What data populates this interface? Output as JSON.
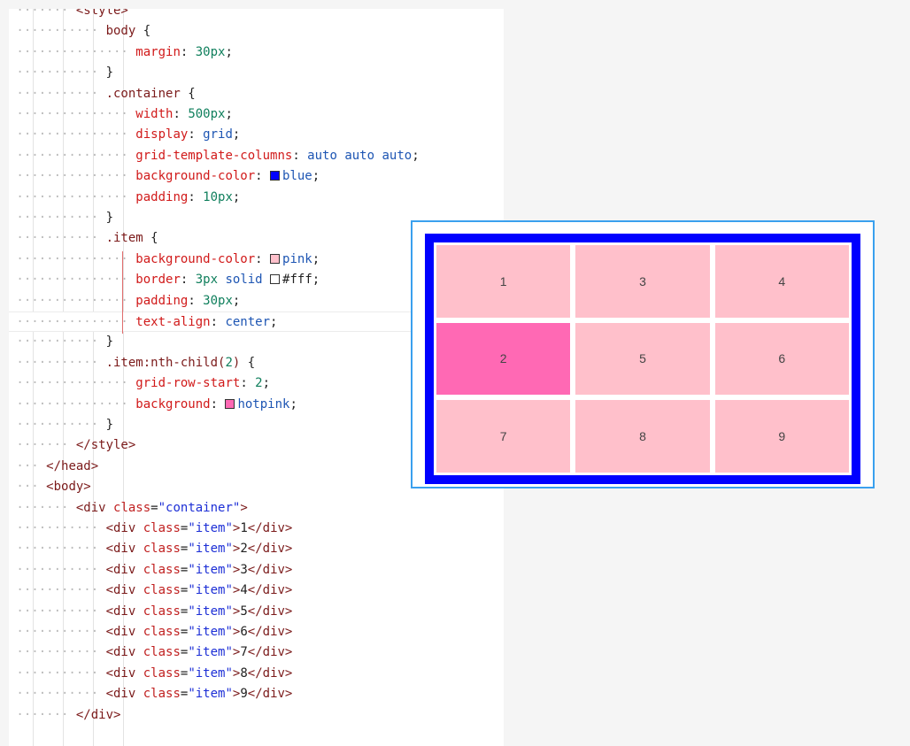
{
  "editor": {
    "lines": [
      {
        "indent": 2,
        "parts": [
          [
            "t-tag",
            "<style>"
          ]
        ]
      },
      {
        "indent": 3,
        "parts": [
          [
            "t-sel",
            "body"
          ],
          [
            "t-punc",
            " {"
          ]
        ]
      },
      {
        "indent": 4,
        "parts": [
          [
            "t-prop",
            "margin"
          ],
          [
            "t-punc",
            ": "
          ],
          [
            "t-num",
            "30px"
          ],
          [
            "t-punc",
            ";"
          ]
        ]
      },
      {
        "indent": 3,
        "parts": [
          [
            "t-punc",
            "}"
          ]
        ]
      },
      {
        "indent": 3,
        "parts": [
          [
            "t-sel",
            ".container"
          ],
          [
            "t-punc",
            " {"
          ]
        ]
      },
      {
        "indent": 4,
        "parts": [
          [
            "t-prop",
            "width"
          ],
          [
            "t-punc",
            ": "
          ],
          [
            "t-num",
            "500px"
          ],
          [
            "t-punc",
            ";"
          ]
        ]
      },
      {
        "indent": 4,
        "parts": [
          [
            "t-prop",
            "display"
          ],
          [
            "t-punc",
            ": "
          ],
          [
            "t-val",
            "grid"
          ],
          [
            "t-punc",
            ";"
          ]
        ]
      },
      {
        "indent": 4,
        "parts": [
          [
            "t-prop",
            "grid-template-columns"
          ],
          [
            "t-punc",
            ": "
          ],
          [
            "t-val",
            "auto auto auto"
          ],
          [
            "t-punc",
            ";"
          ]
        ]
      },
      {
        "indent": 4,
        "parts": [
          [
            "t-prop",
            "background-color"
          ],
          [
            "t-punc",
            ": "
          ],
          [
            "swatch",
            "#0000ff"
          ],
          [
            "t-val",
            "blue"
          ],
          [
            "t-punc",
            ";"
          ]
        ]
      },
      {
        "indent": 4,
        "parts": [
          [
            "t-prop",
            "padding"
          ],
          [
            "t-punc",
            ": "
          ],
          [
            "t-num",
            "10px"
          ],
          [
            "t-punc",
            ";"
          ]
        ]
      },
      {
        "indent": 3,
        "parts": [
          [
            "t-punc",
            "}"
          ]
        ]
      },
      {
        "indent": 3,
        "parts": [
          [
            "t-sel",
            ".item"
          ],
          [
            "t-punc",
            " {"
          ]
        ]
      },
      {
        "indent": 4,
        "parts": [
          [
            "t-prop",
            "background-color"
          ],
          [
            "t-punc",
            ": "
          ],
          [
            "swatch",
            "#ffc0cb"
          ],
          [
            "t-val",
            "pink"
          ],
          [
            "t-punc",
            ";"
          ]
        ]
      },
      {
        "indent": 4,
        "parts": [
          [
            "t-prop",
            "border"
          ],
          [
            "t-punc",
            ": "
          ],
          [
            "t-num",
            "3px"
          ],
          [
            "t-val",
            " solid "
          ],
          [
            "swatch",
            "#ffffff"
          ],
          [
            "t-punc",
            "#fff;"
          ]
        ]
      },
      {
        "indent": 4,
        "parts": [
          [
            "t-prop",
            "padding"
          ],
          [
            "t-punc",
            ": "
          ],
          [
            "t-num",
            "30px"
          ],
          [
            "t-punc",
            ";"
          ]
        ]
      },
      {
        "indent": 4,
        "highlight": true,
        "parts": [
          [
            "t-prop",
            "text-align"
          ],
          [
            "t-punc",
            ": "
          ],
          [
            "t-val",
            "center"
          ],
          [
            "t-punc",
            ";"
          ]
        ]
      },
      {
        "indent": 3,
        "parts": [
          [
            "t-punc",
            "}"
          ]
        ]
      },
      {
        "indent": 3,
        "parts": [
          [
            "t-sel",
            ".item:nth-child("
          ],
          [
            "t-num",
            "2"
          ],
          [
            "t-sel",
            ")"
          ],
          [
            "t-punc",
            " {"
          ]
        ]
      },
      {
        "indent": 4,
        "parts": [
          [
            "t-prop",
            "grid-row-start"
          ],
          [
            "t-punc",
            ": "
          ],
          [
            "t-num",
            "2"
          ],
          [
            "t-punc",
            ";"
          ]
        ]
      },
      {
        "indent": 4,
        "parts": [
          [
            "t-prop",
            "background"
          ],
          [
            "t-punc",
            ": "
          ],
          [
            "swatch",
            "#ff69b4"
          ],
          [
            "t-val",
            "hotpink"
          ],
          [
            "t-punc",
            ";"
          ]
        ]
      },
      {
        "indent": 3,
        "parts": [
          [
            "t-punc",
            "}"
          ]
        ]
      },
      {
        "indent": 2,
        "parts": [
          [
            "t-tag",
            "</style>"
          ]
        ]
      },
      {
        "indent": 1,
        "parts": [
          [
            "t-tag",
            "</head>"
          ]
        ]
      },
      {
        "indent": 1,
        "parts": [
          [
            "t-tag",
            "<body>"
          ]
        ]
      },
      {
        "indent": 2,
        "parts": [
          [
            "t-tag",
            "<div "
          ],
          [
            "t-attr",
            "class"
          ],
          [
            "t-punc",
            "="
          ],
          [
            "t-str",
            "\"container\""
          ],
          [
            "t-tag",
            ">"
          ]
        ]
      },
      {
        "indent": 3,
        "parts": [
          [
            "t-tag",
            "<div "
          ],
          [
            "t-attr",
            "class"
          ],
          [
            "t-punc",
            "="
          ],
          [
            "t-str",
            "\"item\""
          ],
          [
            "t-tag",
            ">"
          ],
          [
            "t-punc",
            "1"
          ],
          [
            "t-tag",
            "</div>"
          ]
        ]
      },
      {
        "indent": 3,
        "parts": [
          [
            "t-tag",
            "<div "
          ],
          [
            "t-attr",
            "class"
          ],
          [
            "t-punc",
            "="
          ],
          [
            "t-str",
            "\"item\""
          ],
          [
            "t-tag",
            ">"
          ],
          [
            "t-punc",
            "2"
          ],
          [
            "t-tag",
            "</div>"
          ]
        ]
      },
      {
        "indent": 3,
        "parts": [
          [
            "t-tag",
            "<div "
          ],
          [
            "t-attr",
            "class"
          ],
          [
            "t-punc",
            "="
          ],
          [
            "t-str",
            "\"item\""
          ],
          [
            "t-tag",
            ">"
          ],
          [
            "t-punc",
            "3"
          ],
          [
            "t-tag",
            "</div>"
          ]
        ]
      },
      {
        "indent": 3,
        "parts": [
          [
            "t-tag",
            "<div "
          ],
          [
            "t-attr",
            "class"
          ],
          [
            "t-punc",
            "="
          ],
          [
            "t-str",
            "\"item\""
          ],
          [
            "t-tag",
            ">"
          ],
          [
            "t-punc",
            "4"
          ],
          [
            "t-tag",
            "</div>"
          ]
        ]
      },
      {
        "indent": 3,
        "parts": [
          [
            "t-tag",
            "<div "
          ],
          [
            "t-attr",
            "class"
          ],
          [
            "t-punc",
            "="
          ],
          [
            "t-str",
            "\"item\""
          ],
          [
            "t-tag",
            ">"
          ],
          [
            "t-punc",
            "5"
          ],
          [
            "t-tag",
            "</div>"
          ]
        ]
      },
      {
        "indent": 3,
        "parts": [
          [
            "t-tag",
            "<div "
          ],
          [
            "t-attr",
            "class"
          ],
          [
            "t-punc",
            "="
          ],
          [
            "t-str",
            "\"item\""
          ],
          [
            "t-tag",
            ">"
          ],
          [
            "t-punc",
            "6"
          ],
          [
            "t-tag",
            "</div>"
          ]
        ]
      },
      {
        "indent": 3,
        "parts": [
          [
            "t-tag",
            "<div "
          ],
          [
            "t-attr",
            "class"
          ],
          [
            "t-punc",
            "="
          ],
          [
            "t-str",
            "\"item\""
          ],
          [
            "t-tag",
            ">"
          ],
          [
            "t-punc",
            "7"
          ],
          [
            "t-tag",
            "</div>"
          ]
        ]
      },
      {
        "indent": 3,
        "parts": [
          [
            "t-tag",
            "<div "
          ],
          [
            "t-attr",
            "class"
          ],
          [
            "t-punc",
            "="
          ],
          [
            "t-str",
            "\"item\""
          ],
          [
            "t-tag",
            ">"
          ],
          [
            "t-punc",
            "8"
          ],
          [
            "t-tag",
            "</div>"
          ]
        ]
      },
      {
        "indent": 3,
        "parts": [
          [
            "t-tag",
            "<div "
          ],
          [
            "t-attr",
            "class"
          ],
          [
            "t-punc",
            "="
          ],
          [
            "t-str",
            "\"item\""
          ],
          [
            "t-tag",
            ">"
          ],
          [
            "t-punc",
            "9"
          ],
          [
            "t-tag",
            "</div>"
          ]
        ]
      },
      {
        "indent": 2,
        "parts": [
          [
            "t-tag",
            "</div>"
          ]
        ]
      }
    ]
  },
  "preview": {
    "container_color": "#0000ff",
    "item_color": "#ffc0cb",
    "hot_color": "#ff69b4",
    "items": [
      "1",
      "2",
      "3",
      "4",
      "5",
      "6",
      "7",
      "8",
      "9"
    ]
  }
}
